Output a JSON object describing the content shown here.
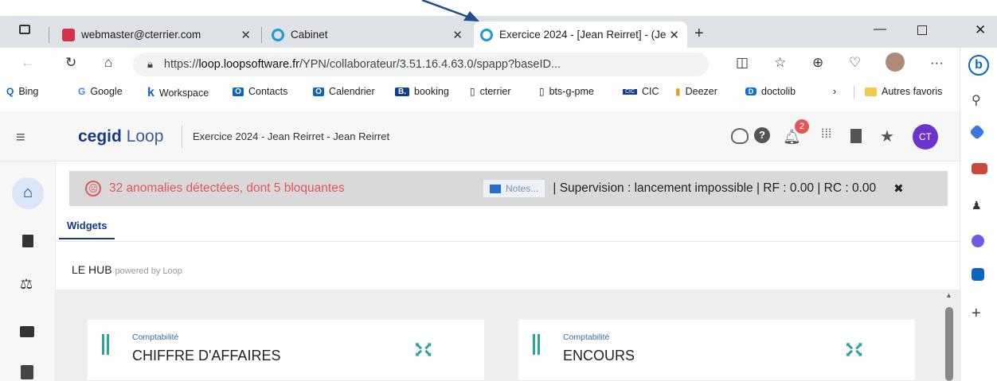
{
  "browser": {
    "tabs": [
      {
        "title": "webmaster@cterrier.com"
      },
      {
        "title": "Cabinet"
      },
      {
        "title": "Exercice 2024 - [Jean Reirret] - (Je"
      }
    ],
    "url_prefix": "https://",
    "url_domain": "loop.loopsoftware.fr",
    "url_path": "/YPN/collaborateur/3.51.16.4.63.0/spapp?baseID...",
    "bookmarks": [
      {
        "label": "Bing",
        "icon": "Q"
      },
      {
        "label": "Google",
        "icon": "G"
      },
      {
        "label": "Workspace",
        "icon": "k"
      },
      {
        "label": "Contacts",
        "icon": "O"
      },
      {
        "label": "Calendrier",
        "icon": "O"
      },
      {
        "label": "booking",
        "icon": "B."
      },
      {
        "label": "cterrier",
        "icon": "▯"
      },
      {
        "label": "bts-g-pme",
        "icon": "▯"
      },
      {
        "label": "CIC",
        "icon": "CIC"
      },
      {
        "label": "Deezer",
        "icon": "▮"
      },
      {
        "label": "doctolib",
        "icon": "D"
      }
    ],
    "bookmarks_more": "Autres favoris",
    "colors": {
      "accent": "#0b66c3",
      "tabstrip": "#dee1e6"
    }
  },
  "app": {
    "brand_bold": "cegid",
    "brand_light": "Loop",
    "title": "Exercice 2024 - Jean Reirret - Jean Reirret",
    "notification_count": "2",
    "user_initials": "CT",
    "colors": {
      "brand": "#123a8c",
      "avatar": "#6b35c9",
      "anomaly": "#e25757",
      "teal": "#2aa59a"
    }
  },
  "alert": {
    "anomaly_text": "32 anomalies détectées, dont 5 bloquantes",
    "notes_label": "Notes...",
    "status_text": "| Supervision : lancement impossible | RF : 0.00 | RC : 0.00"
  },
  "main": {
    "tab_label": "Widgets",
    "hub_title": "LE HUB",
    "hub_sub": "powered by Loop",
    "cards": [
      {
        "category": "Comptabilité",
        "title": "CHIFFRE D'AFFAIRES"
      },
      {
        "category": "Comptabilité",
        "title": "ENCOURS"
      }
    ]
  }
}
